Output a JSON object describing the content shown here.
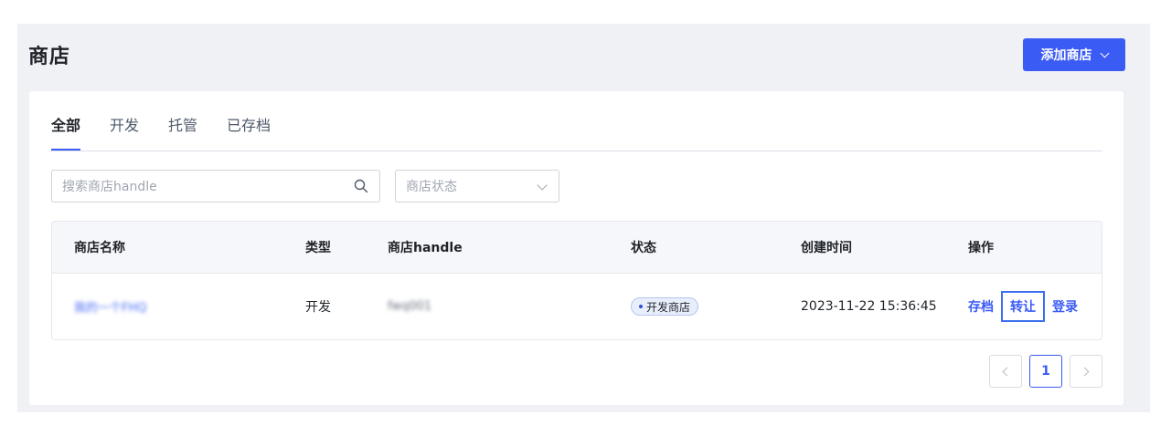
{
  "header": {
    "title": "商店",
    "add_button_label": "添加商店"
  },
  "tabs": [
    {
      "label": "全部",
      "active": true
    },
    {
      "label": "开发",
      "active": false
    },
    {
      "label": "托管",
      "active": false
    },
    {
      "label": "已存档",
      "active": false
    }
  ],
  "filters": {
    "search_placeholder": "搜索商店handle",
    "status_placeholder": "商店状态"
  },
  "table": {
    "columns": [
      "商店名称",
      "类型",
      "商店handle",
      "状态",
      "创建时间",
      "操作"
    ],
    "rows": [
      {
        "name": "我的一个FHQ",
        "type": "开发",
        "handle": "fwq001",
        "status": "开发商店",
        "created": "2023-11-22 15:36:45",
        "actions": [
          "存档",
          "转让",
          "登录"
        ]
      }
    ]
  },
  "pagination": {
    "current_page": "1"
  },
  "colors": {
    "accent": "#3b5bf5",
    "page_bg": "#f0f1f4"
  }
}
